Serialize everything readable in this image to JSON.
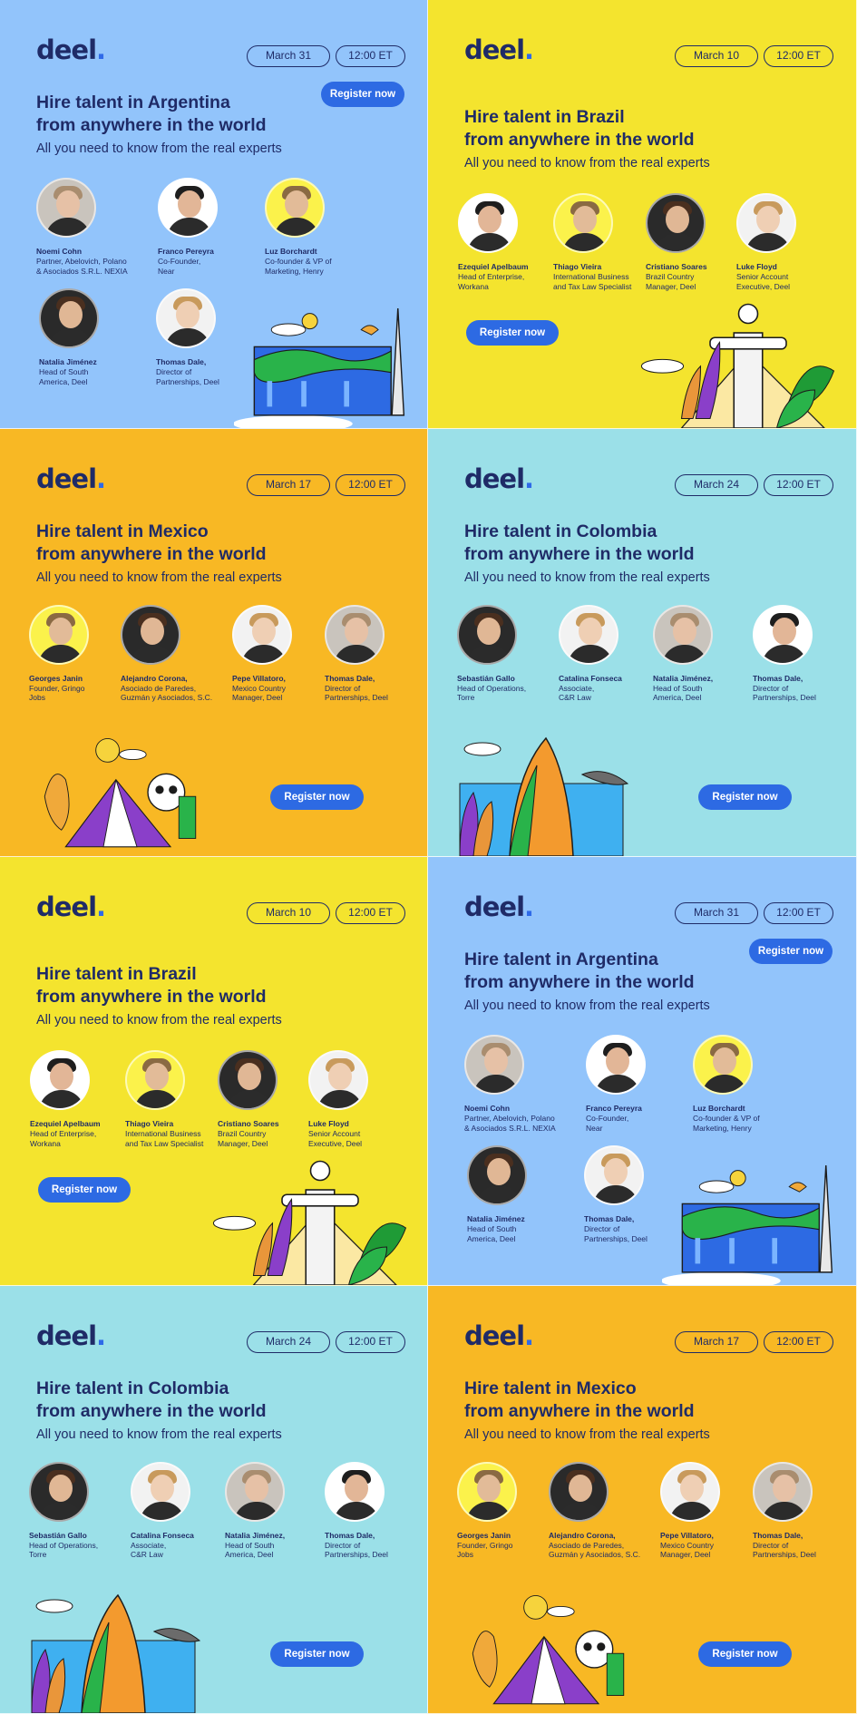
{
  "brand": "deel",
  "brand_dot": ".",
  "common": {
    "subtitle": "All you need to know from the real experts",
    "time": "12:00 ET",
    "register": "Register now"
  },
  "colors": {
    "blue_bg": "#92c4fb",
    "yellow_bg": "#f4e42e",
    "orange_bg": "#f8b824",
    "teal_bg": "#9be0e8",
    "accent": "#2d6ae3",
    "navy": "#1f2b67"
  },
  "cards": [
    {
      "country": "Argentina",
      "title_line1": "Hire talent in Argentina",
      "title_line2": "from anywhere in the world",
      "date": "March 31",
      "speakers": [
        {
          "name": "Noemi Cohn",
          "role1": "Partner, Abelovich, Polano",
          "role2": "& Asociados S.R.L. NEXIA"
        },
        {
          "name": "Franco Pereyra",
          "role1": "Co-Founder,",
          "role2": "Near"
        },
        {
          "name": "Luz Borchardt",
          "role1": "Co-founder & VP of",
          "role2": "Marketing, Henry"
        },
        {
          "name": "Natalia Jiménez",
          "role1": "Head of South",
          "role2": "America, Deel"
        },
        {
          "name": "Thomas Dale,",
          "role1": "Director of",
          "role2": "Partnerships, Deel"
        }
      ]
    },
    {
      "country": "Brazil",
      "title_line1": "Hire talent in Brazil",
      "title_line2": "from anywhere in the world",
      "date": "March 10",
      "speakers": [
        {
          "name": "Ezequiel Apelbaum",
          "role1": "Head of Enterprise,",
          "role2": "Workana"
        },
        {
          "name": "Thiago Vieira",
          "role1": "International Business",
          "role2": "and Tax Law Specialist"
        },
        {
          "name": "Cristiano Soares",
          "role1": "Brazil Country",
          "role2": "Manager, Deel"
        },
        {
          "name": "Luke Floyd",
          "role1": "Senior Account",
          "role2": "Executive, Deel"
        }
      ]
    },
    {
      "country": "Mexico",
      "title_line1": "Hire talent in Mexico",
      "title_line2": "from anywhere in the world",
      "date": "March 17",
      "speakers": [
        {
          "name": "Georges Janin",
          "role1": "Founder, Gringo",
          "role2": "Jobs"
        },
        {
          "name": "Alejandro Corona,",
          "role1": "Asociado de Paredes,",
          "role2": "Guzmán y Asociados, S.C."
        },
        {
          "name": "Pepe Villatoro,",
          "role1": "Mexico Country",
          "role2": "Manager, Deel"
        },
        {
          "name": "Thomas Dale,",
          "role1": "Director of",
          "role2": "Partnerships, Deel"
        }
      ]
    },
    {
      "country": "Colombia",
      "title_line1": "Hire talent in Colombia",
      "title_line2": "from anywhere in the world",
      "date": "March 24",
      "speakers": [
        {
          "name": "Sebastián Gallo",
          "role1": "Head of Operations,",
          "role2": "Torre"
        },
        {
          "name": "Catalina Fonseca",
          "role1": "Associate,",
          "role2": "C&R Law"
        },
        {
          "name": "Natalia Jiménez,",
          "role1": "Head of South",
          "role2": "America, Deel"
        },
        {
          "name": "Thomas Dale,",
          "role1": "Director of",
          "role2": "Partnerships, Deel"
        }
      ]
    }
  ]
}
